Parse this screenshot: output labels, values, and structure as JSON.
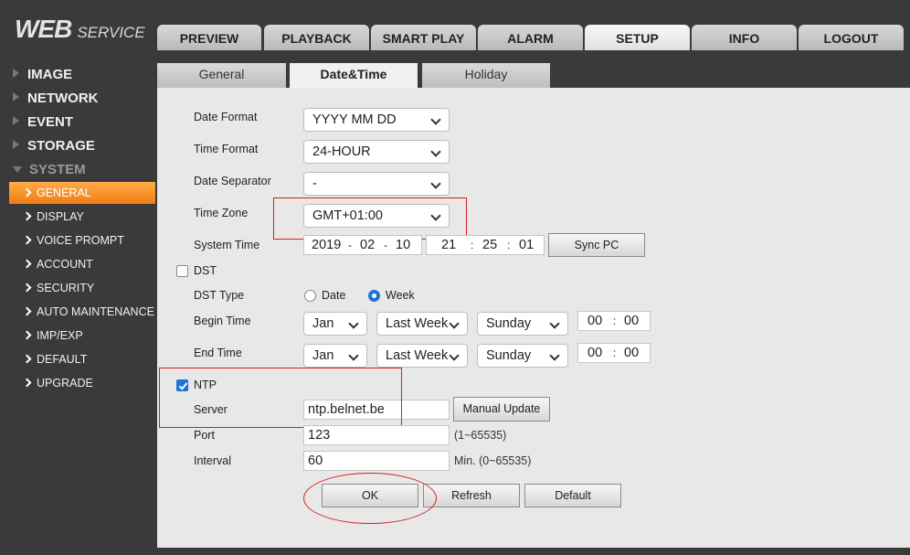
{
  "logo": {
    "web": "WEB",
    "service": "SERVICE"
  },
  "nav": [
    "PREVIEW",
    "PLAYBACK",
    "SMART PLAY",
    "ALARM",
    "SETUP",
    "INFO",
    "LOGOUT"
  ],
  "sidebar": {
    "sections": [
      "IMAGE",
      "NETWORK",
      "EVENT",
      "STORAGE",
      "SYSTEM"
    ],
    "items": [
      "GENERAL",
      "DISPLAY",
      "VOICE PROMPT",
      "ACCOUNT",
      "SECURITY",
      "AUTO MAINTENANCE",
      "IMP/EXP",
      "DEFAULT",
      "UPGRADE"
    ]
  },
  "subtabs": [
    "General",
    "Date&Time",
    "Holiday"
  ],
  "form": {
    "date_format": {
      "label": "Date Format",
      "value": "YYYY MM DD"
    },
    "time_format": {
      "label": "Time Format",
      "value": "24-HOUR"
    },
    "date_separator": {
      "label": "Date Separator",
      "value": "-"
    },
    "time_zone": {
      "label": "Time Zone",
      "value": "GMT+01:00"
    },
    "system_time": {
      "label": "System Time",
      "year": "2019",
      "month": "02",
      "day": "10",
      "date_sep": "-",
      "hour": "21",
      "minute": "25",
      "second": "01",
      "time_sep": ":",
      "sync_label": "Sync PC"
    },
    "dst": {
      "label": "DST",
      "checked": false
    },
    "dst_type": {
      "label": "DST Type",
      "opt_date": "Date",
      "opt_week": "Week",
      "selected": "Week"
    },
    "begin_time": {
      "label": "Begin Time",
      "month": "Jan",
      "week": "Last Week",
      "day": "Sunday",
      "hour": "00",
      "minute": "00",
      "sep": ":"
    },
    "end_time": {
      "label": "End Time",
      "month": "Jan",
      "week": "Last Week",
      "day": "Sunday",
      "hour": "00",
      "minute": "00",
      "sep": ":"
    },
    "ntp": {
      "label": "NTP",
      "checked": true
    },
    "server": {
      "label": "Server",
      "value": "ntp.belnet.be",
      "button": "Manual Update"
    },
    "port": {
      "label": "Port",
      "value": "123",
      "hint": "(1~65535)"
    },
    "interval": {
      "label": "Interval",
      "value": "60",
      "hint": "Min. (0~65535)"
    }
  },
  "buttons": {
    "ok": "OK",
    "refresh": "Refresh",
    "default": "Default"
  },
  "colors": {
    "accent": "#f07c12",
    "annotation": "#d42020",
    "checkbox": "#1e74d8"
  }
}
